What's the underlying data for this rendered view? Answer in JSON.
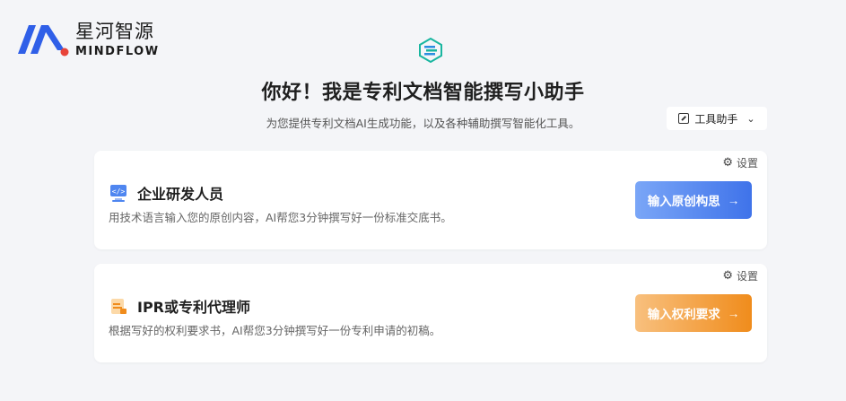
{
  "brand": {
    "name_cn": "星河智源",
    "name_en": "MINDFLOW"
  },
  "hero": {
    "title": "你好！我是专利文档智能撰写小助手",
    "subtitle": "为您提供专利文档AI生成功能，以及各种辅助撰写智能化工具。"
  },
  "tool_select": {
    "label": "工具助手",
    "icon": "edit-square-icon"
  },
  "cards": [
    {
      "title": "企业研发人员",
      "description": "用技术语言输入您的原创内容，AI帮您3分钟撰写好一份标准交底书。",
      "settings_label": "设置",
      "button_label": "输入原创构思",
      "button_arrow": "→",
      "icon": "code-monitor-icon"
    },
    {
      "title": "IPR或专利代理师",
      "description": "根据写好的权利要求书，AI帮您3分钟撰写好一份专利申请的初稿。",
      "settings_label": "设置",
      "button_label": "输入权利要求",
      "button_arrow": "→",
      "icon": "document-icon"
    }
  ],
  "colors": {
    "accent_blue": "#3f73ea",
    "accent_orange": "#f08c1c",
    "logo_blue": "#2f5fe8",
    "logo_red": "#e8443a"
  }
}
